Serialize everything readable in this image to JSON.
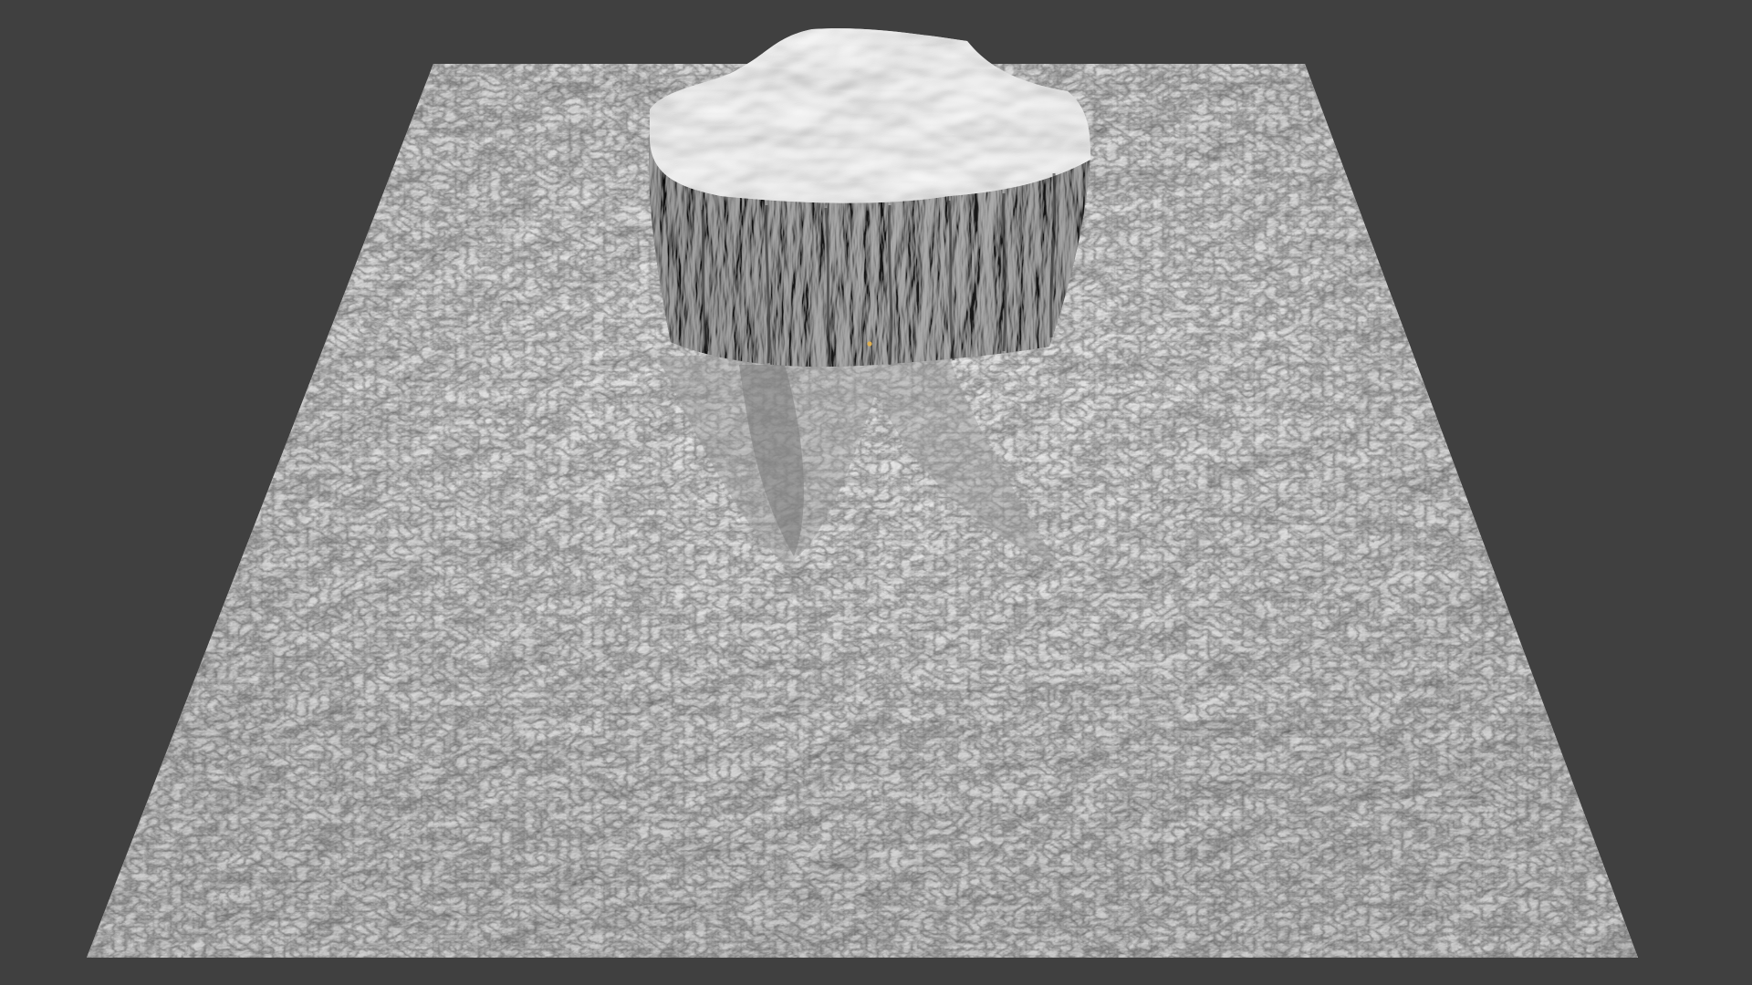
{
  "viewport": {
    "background_color": "#404040",
    "object": "terrain-mesh",
    "shading": "solid",
    "surface_color": "#c9c9c9",
    "shadow_color": "#2a2a2a",
    "origin_marker_color": "#e0b050"
  }
}
